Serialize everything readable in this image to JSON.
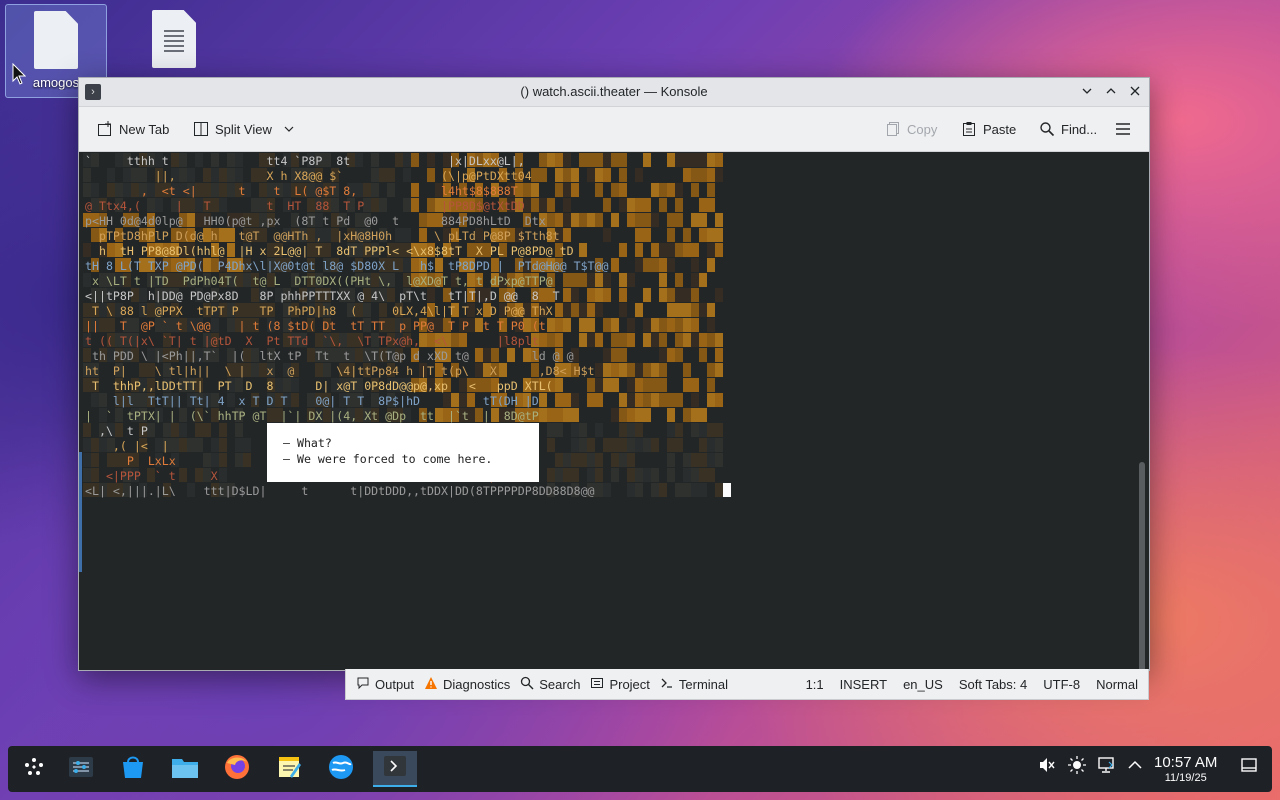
{
  "desktop": {
    "icons": [
      {
        "label": "amogos"
      },
      {
        "label": ""
      }
    ]
  },
  "window": {
    "title": "() watch.ascii.theater — Konsole",
    "toolbar": {
      "new_tab": "New Tab",
      "split_view": "Split View",
      "copy": "Copy",
      "paste": "Paste",
      "find": "Find..."
    },
    "terminal": {
      "rows": [
        "`     tthh t              tt4 `P8P  8t              |x|DLxx@L|,  ",
        "          ||,             X h X8@@ $`              (\\|p@PtDXtt04 ",
        "        ,  <t <|      t    t  L( @$T 8,            l4ht$8$888T   ",
        "@ Ttx4,(     |   T        t  HT  88  T P           |PP8D$@tXtDD  ",
        "p<HH 0d@4d0lp@   HH0(p@t ,px  (8T t Pd  @0  t      884PD8hLtD  Dtx",
        "  pTPtD8hPlP D(d@ h   t@T  @@HTh ,  |xH@8H0h      \\ pLTd P@8P $Tth8t",
        "  h  tH PP8@8Dl(hhl@  |H x 2L@@| T  8dT PPPl< <\\x8$8tT  X PL P@8PD@ tD",
        "tH 8 L(T TXP @PD(  P4Dhx\\l|X@0t@t l8@ $D80X L   h$  tP8DPD |  PTd@H@@ T$T@@",
        " x \\LT t |TD  PdPh04T(  t@ L  DTT0DX((PHt \\,  l@XD@T t, t dPxp@TTP@",
        "<||tP8P  h|DD@ PD@Px8D   8P phhPPTTTXX @ 4\\  pT\\t   tT|T|,D @@  8  T",
        " T \\ 88 l @PPX  tTPT P   TP  PhPD|h8  (     0LX,4\\l|T T x D P@@ ThX",
        "||   T  @P ` t \\@@    | t (8 $tD( Dt  tT TT  p PP@  T P  t T P0 (t",
        "t (( T(|x\\ `T| t |@tD  X  Pt TTd  `\\,  \\T TPx@h,  <\\       |l8plt",
        " th PDD \\ |<Ph||,T`  |(  ltX tP  Tt  t  \\T(T@p d xXD t@         ld @ @",
        "ht  P|    \\ tl|h||  \\ |   x  @      \\4|ttPp84 h |T t(p\\   X      ,D8< H$t",
        " T  thhP,,lDDtTT|  PT  D  8      D| x@T 0P8dD@@p@,xp   <   ppD XTL(",
        "    l|l  TtT|| Tt| 4  x T D T    0@| T T  8P$|hD         tT(DH |D",
        "|  `  tPTX| |  (\\` hhTP @T  |`| DX |(4, Xt @Dp  tt  |`t  |  8D@tP",
        "  ,\\  t P                           |,lL(PD(  xxL< 8TD",
        "    ,( |<  |                          ,h,xl| `T`| TH8T`TD8888",
        "      P  LxLx                         DX||PP,L,h,xHp4xpx@$T$x",
        "   <|PPP  ` t     X                   tDD@<D8@hDD88dX@4@@HpHH",
        "<L| <,|||.|L\\    ttt|D$LD|     t      t|DDtDDD,,tDDX|DD(8TPPPPDP8DD88D8@@"
      ],
      "popup_lines": [
        "– What?",
        "– We were forced to come here."
      ]
    },
    "statusbar": {
      "output": "Output",
      "diagnostics": "Diagnostics",
      "search": "Search",
      "project": "Project",
      "terminal": "Terminal",
      "position": "1:1",
      "mode": "INSERT",
      "language": "en_US",
      "indent": "Soft Tabs: 4",
      "encoding": "UTF-8",
      "input_mode": "Normal"
    }
  },
  "taskbar": {
    "clock_time": "10:57 AM",
    "clock_date": "11/19/25"
  },
  "colors": {
    "terminal_bg": "#232627",
    "accent": "#3daee9"
  }
}
